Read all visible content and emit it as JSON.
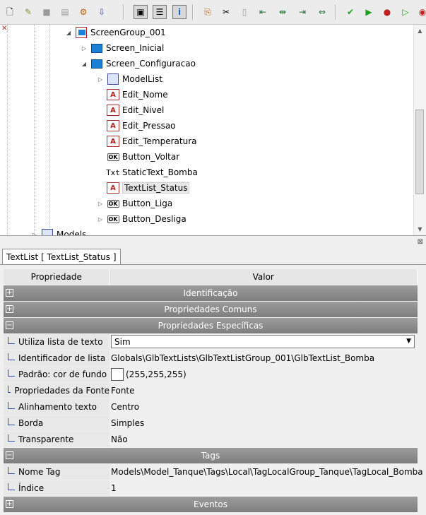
{
  "toolbar": {
    "buttons": [
      {
        "icon": "new-file-icon",
        "glyph": "🗋"
      },
      {
        "icon": "open-folder-icon",
        "glyph": "✎"
      },
      {
        "icon": "save-disabled-icon",
        "glyph": "■"
      },
      {
        "icon": "save-icon",
        "glyph": "▤"
      },
      {
        "icon": "network-icon",
        "glyph": "⚙"
      },
      {
        "icon": "download-icon",
        "glyph": "⇩"
      },
      {
        "icon": "screen-view-icon",
        "glyph": "▣"
      },
      {
        "icon": "list-view-icon",
        "glyph": "☰"
      },
      {
        "icon": "info-icon",
        "glyph": "i"
      },
      {
        "icon": "copy-icon",
        "glyph": "⎘"
      },
      {
        "icon": "cut-icon",
        "glyph": "✂"
      },
      {
        "icon": "paste-disabled-icon",
        "glyph": "▯"
      },
      {
        "icon": "align-left-icon",
        "glyph": "⇤"
      },
      {
        "icon": "align-center-icon",
        "glyph": "⇹"
      },
      {
        "icon": "align-right-icon",
        "glyph": "⇥"
      },
      {
        "icon": "distribute-icon",
        "glyph": "⇔"
      },
      {
        "icon": "build-icon",
        "glyph": "✔"
      },
      {
        "icon": "run-icon",
        "glyph": "▶"
      },
      {
        "icon": "stop-icon",
        "glyph": "●"
      },
      {
        "icon": "simulate-icon",
        "glyph": "▷"
      },
      {
        "icon": "simulate-stop-icon",
        "glyph": "◉"
      }
    ]
  },
  "tree": {
    "items": [
      {
        "label": "ScreenGroup_001",
        "expander": "◢",
        "icon": "group"
      },
      {
        "label": "Screen_Inicial",
        "expander": "▷",
        "icon": "screen"
      },
      {
        "label": "Screen_Configuracao",
        "expander": "◢",
        "icon": "screen"
      },
      {
        "label": "ModelList",
        "expander": "▷",
        "icon": "list"
      },
      {
        "label": "Edit_Nome",
        "expander": "",
        "icon": "edit"
      },
      {
        "label": "Edit_Nivel",
        "expander": "",
        "icon": "edit"
      },
      {
        "label": "Edit_Pressao",
        "expander": "",
        "icon": "edit"
      },
      {
        "label": "Edit_Temperatura",
        "expander": "",
        "icon": "edit"
      },
      {
        "label": "Button_Voltar",
        "expander": "",
        "icon": "ok"
      },
      {
        "label": "StaticText_Bomba",
        "expander": "",
        "icon": "txt"
      },
      {
        "label": "TextList_Status",
        "expander": "",
        "icon": "textlist"
      },
      {
        "label": "Button_Liga",
        "expander": "▷",
        "icon": "ok"
      },
      {
        "label": "Button_Desliga",
        "expander": "▷",
        "icon": "ok"
      },
      {
        "label": "Models",
        "expander": "▷",
        "icon": "list"
      }
    ],
    "icon_text": {
      "ok": "OK",
      "txt": "Txt",
      "edit": "A"
    }
  },
  "props": {
    "tab_label": "TextList [ TextList_Status ]",
    "col_property": "Propriedade",
    "col_value": "Valor",
    "cat_identificacao": "Identificação",
    "cat_comuns": "Propriedades Comuns",
    "cat_especificas": "Propriedades Específicas",
    "cat_tags": "Tags",
    "cat_eventos": "Eventos",
    "toggle_collapsed": "+",
    "toggle_expanded": "−",
    "rows": [
      {
        "name": "Utiliza lista de texto",
        "value": "Sim"
      },
      {
        "name": "Identificador de lista",
        "value": "Globals\\GlbTextLists\\GlbTextListGroup_001\\GlbTextList_Bomba"
      },
      {
        "name": "Padrão: cor de fundo",
        "value": "(255,255,255)"
      },
      {
        "name": "Propriedades da Fonte",
        "value": "Fonte"
      },
      {
        "name": "Alinhamento texto",
        "value": "Centro"
      },
      {
        "name": "Borda",
        "value": "Simples"
      },
      {
        "name": "Transparente",
        "value": "Não"
      }
    ],
    "tag_rows": [
      {
        "name": "Nome Tag",
        "value": "Models\\Model_Tanque\\Tags\\Local\\TagLocalGroup_Tanque\\TagLocal_Bomba"
      },
      {
        "name": "Índice",
        "value": "1"
      }
    ]
  },
  "colors": {
    "accent": "#1a7fd6",
    "category": "#8a8a8a"
  }
}
